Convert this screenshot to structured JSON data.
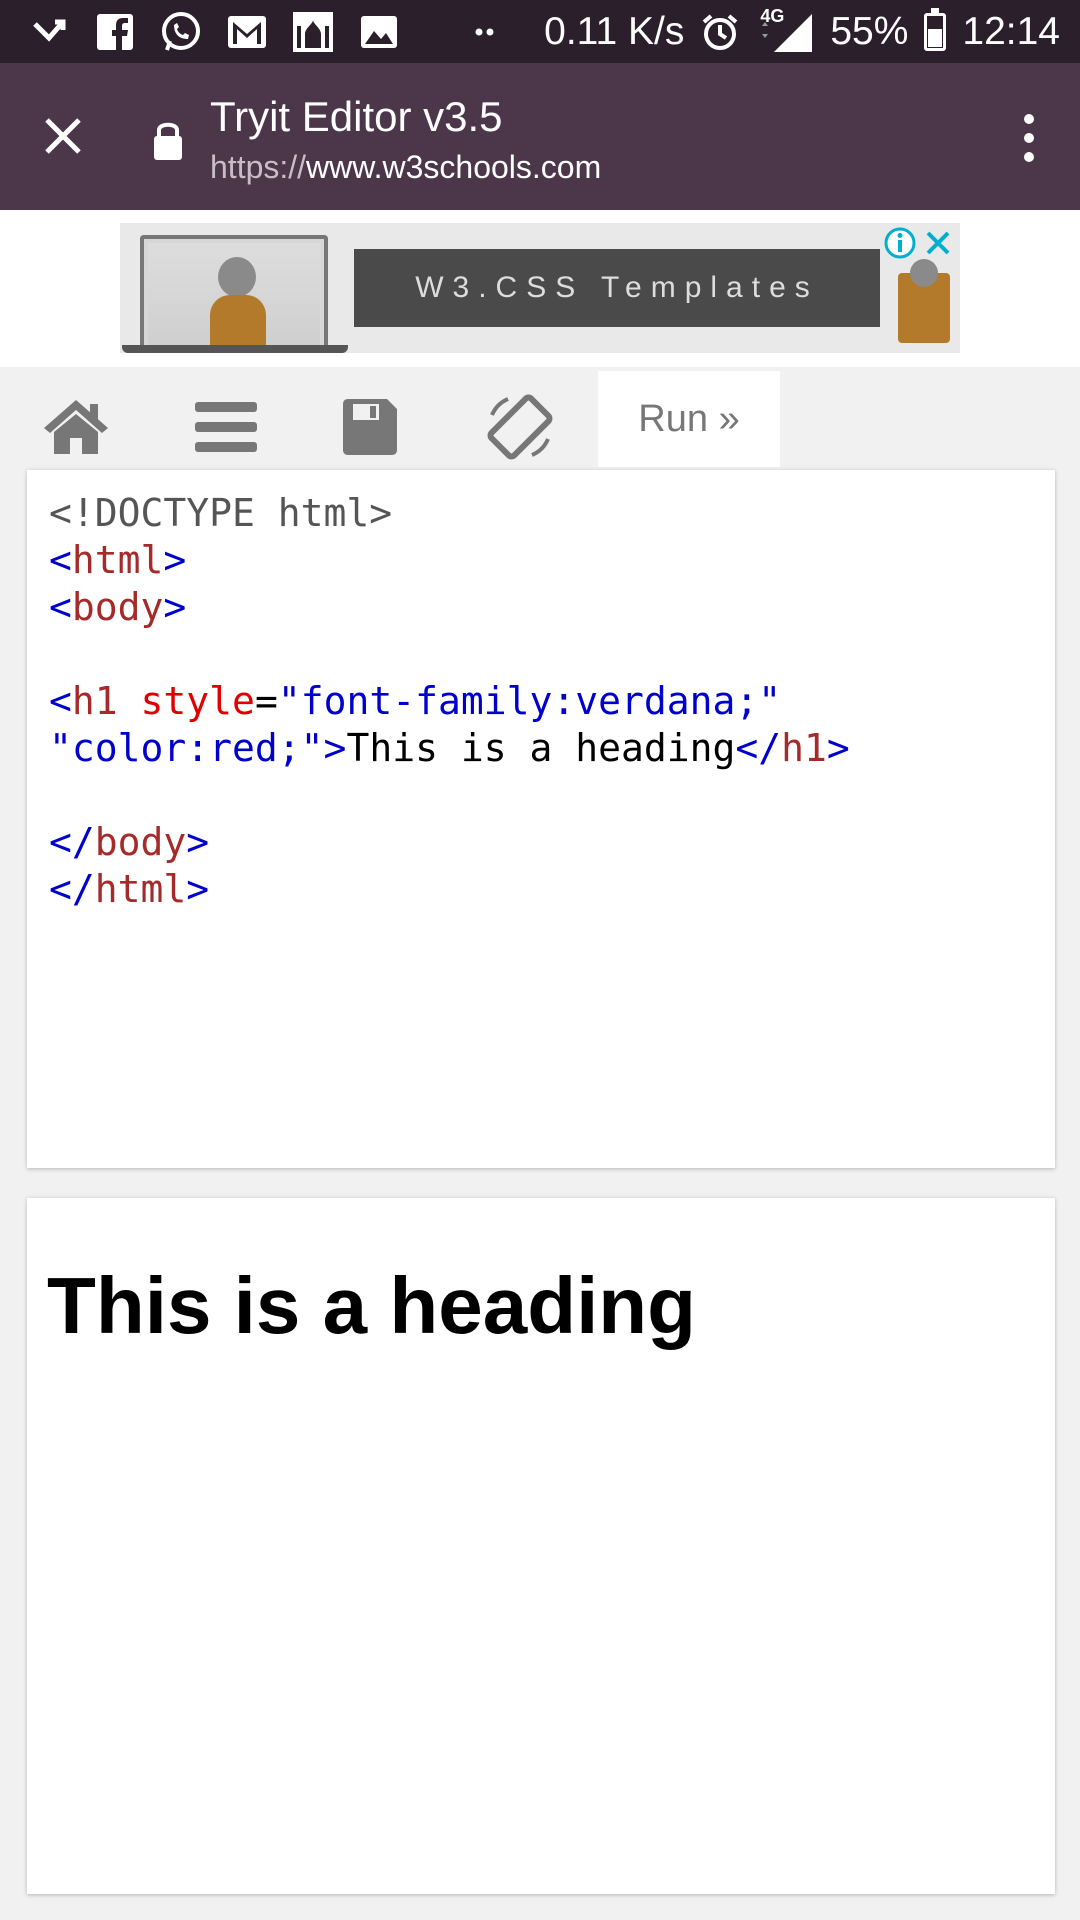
{
  "status_bar": {
    "net_speed": "0.11 K/s",
    "network": "4G",
    "battery": "55%",
    "battery_level": 0.55,
    "time": "12:14",
    "notifications": [
      "missed-call-icon",
      "facebook-icon",
      "whatsapp-icon",
      "gmail-icon",
      "mosque-icon",
      "image-icon",
      "more-dots-icon"
    ]
  },
  "app_bar": {
    "title": "Tryit Editor v3.5",
    "url_scheme": "https://",
    "url_host": "www.w3schools.com"
  },
  "ad": {
    "banner_text": "W3.CSS Templates"
  },
  "toolbar": {
    "buttons": [
      "home-icon",
      "menu-icon",
      "save-icon",
      "rotate-icon"
    ],
    "run_label": "Run »"
  },
  "editor": {
    "line1": "<!DOCTYPE html>",
    "line2_open": "<",
    "line2_name": "html",
    "line2_close": ">",
    "line3_open": "<",
    "line3_name": "body",
    "line3_close": ">",
    "line5_open": "<",
    "line5_name": "h1",
    "line5_space": " ",
    "line5_attr": "style",
    "line5_eq": "=",
    "line5_val": "\"font-family:verdana;\"",
    "line6_val": "\"color:red;\"",
    "line6_gt": ">",
    "line6_text": "This is a heading",
    "line6_close_open": "</",
    "line6_close_name": "h1",
    "line6_close_end": ">",
    "line8_open": "</",
    "line8_name": "body",
    "line8_close": ">",
    "line9_open": "</",
    "line9_name": "html",
    "line9_close": ">"
  },
  "result": {
    "heading": "This is a heading"
  }
}
